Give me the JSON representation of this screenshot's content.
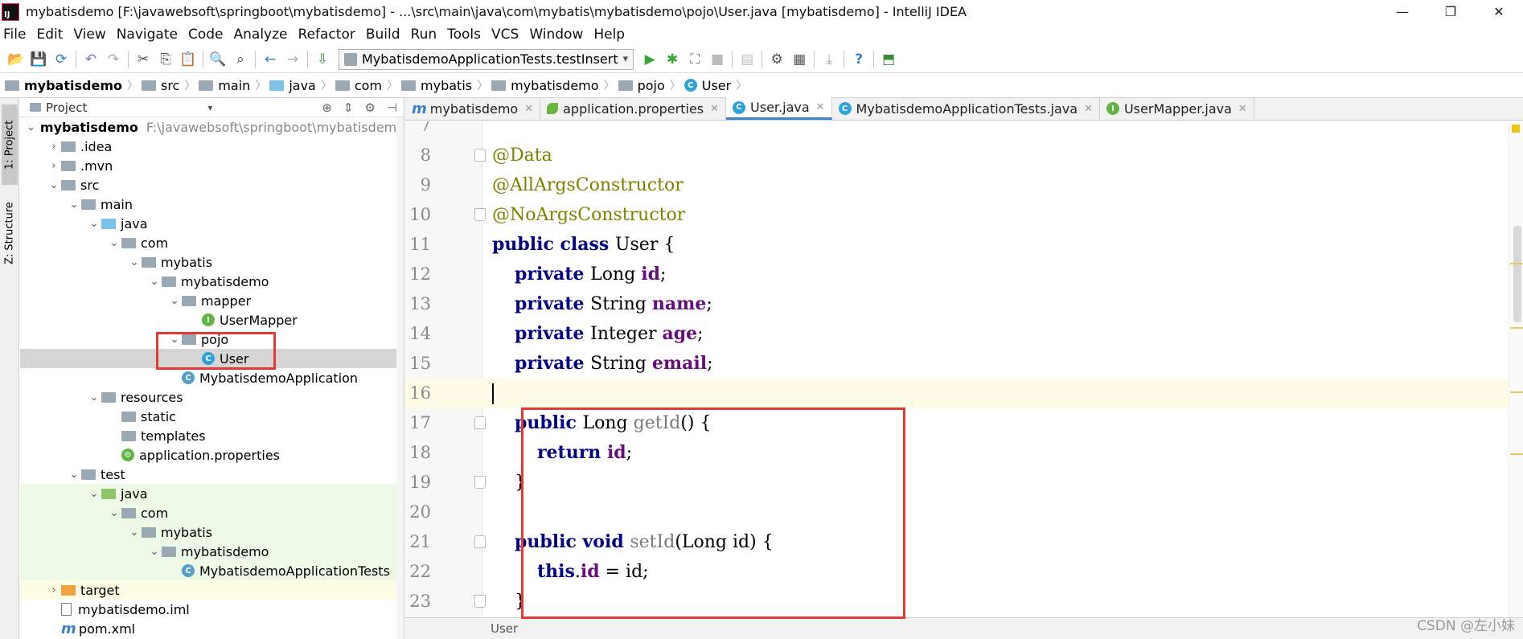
{
  "window": {
    "title": "mybatisdemo [F:\\javawebsoft\\springboot\\mybatisdemo] - ...\\src\\main\\java\\com\\mybatis\\mybatisdemo\\pojo\\User.java [mybatisdemo] - IntelliJ IDEA",
    "app_icon_text": "IJ",
    "controls": [
      "—",
      "❐",
      "✕"
    ]
  },
  "menu": [
    "File",
    "Edit",
    "View",
    "Navigate",
    "Code",
    "Analyze",
    "Refactor",
    "Build",
    "Run",
    "Tools",
    "VCS",
    "Window",
    "Help"
  ],
  "toolbar": {
    "run_config": "MybatisdemoApplicationTests.testInsert",
    "run_config_arrow": "▾",
    "icons": {
      "open": "📂",
      "save": "💾",
      "sync": "⟳",
      "undo": "↶",
      "redo": "↷",
      "cut": "✂",
      "copy": "⎘",
      "paste": "📋",
      "find": "🔍",
      "replace": "⌕",
      "back": "←",
      "forward": "→",
      "build": "⇩",
      "run": "▶",
      "debug": "✱",
      "coverage": "⛶",
      "stop": "■",
      "structure": "▤",
      "settings": "⚙",
      "project_structure": "▦",
      "sdk": "⤓",
      "help": "?",
      "vcs": "⬒"
    }
  },
  "breadcrumb": [
    {
      "label": "mybatisdemo",
      "icon": "folder"
    },
    {
      "label": "src",
      "icon": "folder"
    },
    {
      "label": "main",
      "icon": "folder"
    },
    {
      "label": "java",
      "icon": "folder-blue"
    },
    {
      "label": "com",
      "icon": "folder"
    },
    {
      "label": "mybatis",
      "icon": "folder"
    },
    {
      "label": "mybatisdemo",
      "icon": "folder"
    },
    {
      "label": "pojo",
      "icon": "folder"
    },
    {
      "label": "User",
      "icon": "class"
    }
  ],
  "side_tabs": {
    "project": "1: Project",
    "structure": "Z: Structure"
  },
  "project_panel": {
    "header": "Project",
    "header_arrow": "▾",
    "header_icons": {
      "locate": "⊕",
      "collapse": "⇕",
      "settings": "⚙",
      "hide": "⊣"
    },
    "expanded_arrow": "⌄",
    "collapsed_arrow": "›",
    "rows": [
      {
        "label": "mybatisdemo",
        "extra": "F:\\javawebsoft\\springboot\\mybatisdemo",
        "depth": 0,
        "arrow": "down",
        "icon": "proj",
        "bold": true
      },
      {
        "label": ".idea",
        "depth": 1,
        "arrow": "right",
        "icon": "folder"
      },
      {
        "label": ".mvn",
        "depth": 1,
        "arrow": "right",
        "icon": "folder"
      },
      {
        "label": "src",
        "depth": 1,
        "arrow": "down",
        "icon": "folder"
      },
      {
        "label": "main",
        "depth": 2,
        "arrow": "down",
        "icon": "folder"
      },
      {
        "label": "java",
        "depth": 3,
        "arrow": "down",
        "icon": "folder-blue"
      },
      {
        "label": "com",
        "depth": 4,
        "arrow": "down",
        "icon": "folder"
      },
      {
        "label": "mybatis",
        "depth": 5,
        "arrow": "down",
        "icon": "folder"
      },
      {
        "label": "mybatisdemo",
        "depth": 6,
        "arrow": "down",
        "icon": "folder"
      },
      {
        "label": "mapper",
        "depth": 7,
        "arrow": "down",
        "icon": "folder"
      },
      {
        "label": "UserMapper",
        "depth": 8,
        "arrow": "none",
        "icon": "interface"
      },
      {
        "label": "pojo",
        "depth": 7,
        "arrow": "down",
        "icon": "folder"
      },
      {
        "label": "User",
        "depth": 8,
        "arrow": "none",
        "icon": "class",
        "selected": true
      },
      {
        "label": "MybatisdemoApplication",
        "depth": 7,
        "arrow": "none",
        "icon": "spring-class"
      },
      {
        "label": "resources",
        "depth": 3,
        "arrow": "down",
        "icon": "folder"
      },
      {
        "label": "static",
        "depth": 4,
        "arrow": "none",
        "icon": "folder"
      },
      {
        "label": "templates",
        "depth": 4,
        "arrow": "none",
        "icon": "folder"
      },
      {
        "label": "application.properties",
        "depth": 4,
        "arrow": "none",
        "icon": "spring-props"
      },
      {
        "label": "test",
        "depth": 2,
        "arrow": "down",
        "icon": "folder"
      },
      {
        "label": "java",
        "depth": 3,
        "arrow": "down",
        "icon": "folder-green",
        "bg": "green"
      },
      {
        "label": "com",
        "depth": 4,
        "arrow": "down",
        "icon": "folder",
        "bg": "green"
      },
      {
        "label": "mybatis",
        "depth": 5,
        "arrow": "down",
        "icon": "folder",
        "bg": "green"
      },
      {
        "label": "mybatisdemo",
        "depth": 6,
        "arrow": "down",
        "icon": "folder",
        "bg": "green"
      },
      {
        "label": "MybatisdemoApplicationTests",
        "depth": 7,
        "arrow": "none",
        "icon": "spring-class",
        "bg": "green"
      },
      {
        "label": "target",
        "depth": 1,
        "arrow": "right",
        "icon": "folder-orange",
        "bg": "yellow"
      },
      {
        "label": "mybatisdemo.iml",
        "depth": 1,
        "arrow": "none",
        "icon": "file"
      },
      {
        "label": "pom.xml",
        "depth": 1,
        "arrow": "none",
        "icon": "maven"
      }
    ]
  },
  "editor_tabs": [
    {
      "label": "mybatisdemo",
      "icon": "m",
      "close": "✕"
    },
    {
      "label": "application.properties",
      "icon": "spring",
      "close": "✕"
    },
    {
      "label": "User.java",
      "icon": "class",
      "close": "✕",
      "active": true
    },
    {
      "label": "MybatisdemoApplicationTests.java",
      "icon": "class",
      "close": "✕"
    },
    {
      "label": "UserMapper.java",
      "icon": "interface",
      "close": "✕"
    }
  ],
  "code": [
    {
      "n": "7",
      "tokens": []
    },
    {
      "n": "8",
      "fold": "top",
      "tokens": [
        {
          "t": "@Data",
          "c": "ann"
        }
      ]
    },
    {
      "n": "9",
      "tokens": [
        {
          "t": "@AllArgsConstructor",
          "c": "ann"
        }
      ]
    },
    {
      "n": "10",
      "fold": "bottom",
      "tokens": [
        {
          "t": "@NoArgsConstructor",
          "c": "ann"
        }
      ]
    },
    {
      "n": "11",
      "tokens": [
        {
          "t": "public class ",
          "c": "kw"
        },
        {
          "t": "User {",
          "c": "plain"
        }
      ]
    },
    {
      "n": "12",
      "tokens": [
        {
          "t": "    ",
          "c": "plain"
        },
        {
          "t": "private ",
          "c": "kw"
        },
        {
          "t": "Long ",
          "c": "plain"
        },
        {
          "t": "id",
          "c": "fld"
        },
        {
          "t": ";",
          "c": "plain"
        }
      ]
    },
    {
      "n": "13",
      "tokens": [
        {
          "t": "    ",
          "c": "plain"
        },
        {
          "t": "private ",
          "c": "kw"
        },
        {
          "t": "String ",
          "c": "plain"
        },
        {
          "t": "name",
          "c": "fld"
        },
        {
          "t": ";",
          "c": "plain"
        }
      ]
    },
    {
      "n": "14",
      "tokens": [
        {
          "t": "    ",
          "c": "plain"
        },
        {
          "t": "private ",
          "c": "kw"
        },
        {
          "t": "Integer ",
          "c": "plain"
        },
        {
          "t": "age",
          "c": "fld"
        },
        {
          "t": ";",
          "c": "plain"
        }
      ]
    },
    {
      "n": "15",
      "tokens": [
        {
          "t": "    ",
          "c": "plain"
        },
        {
          "t": "private ",
          "c": "kw"
        },
        {
          "t": "String ",
          "c": "plain"
        },
        {
          "t": "email",
          "c": "fld"
        },
        {
          "t": ";",
          "c": "plain"
        }
      ]
    },
    {
      "n": "16",
      "current": true,
      "tokens": []
    },
    {
      "n": "17",
      "fold": "top",
      "tokens": [
        {
          "t": "    ",
          "c": "plain"
        },
        {
          "t": "public ",
          "c": "kw"
        },
        {
          "t": "Long ",
          "c": "plain"
        },
        {
          "t": "getId",
          "c": "mth-unused"
        },
        {
          "t": "() {",
          "c": "plain"
        }
      ]
    },
    {
      "n": "18",
      "tokens": [
        {
          "t": "        ",
          "c": "plain"
        },
        {
          "t": "return ",
          "c": "kw"
        },
        {
          "t": "id",
          "c": "fld"
        },
        {
          "t": ";",
          "c": "plain"
        }
      ]
    },
    {
      "n": "19",
      "fold": "bottom",
      "tokens": [
        {
          "t": "    }",
          "c": "plain"
        }
      ]
    },
    {
      "n": "20",
      "tokens": []
    },
    {
      "n": "21",
      "fold": "top",
      "tokens": [
        {
          "t": "    ",
          "c": "plain"
        },
        {
          "t": "public void ",
          "c": "kw"
        },
        {
          "t": "setId",
          "c": "mth-unused"
        },
        {
          "t": "(Long id) {",
          "c": "plain"
        }
      ]
    },
    {
      "n": "22",
      "tokens": [
        {
          "t": "        ",
          "c": "plain"
        },
        {
          "t": "this",
          "c": "kw"
        },
        {
          "t": ".",
          "c": "plain"
        },
        {
          "t": "id",
          "c": "fld"
        },
        {
          "t": " = id;",
          "c": "plain"
        }
      ]
    },
    {
      "n": "23",
      "fold": "bottom",
      "tokens": [
        {
          "t": "    }",
          "c": "plain"
        }
      ]
    }
  ],
  "status": {
    "breadcrumb": "User"
  },
  "watermark": "CSDN @左小妹",
  "colors": {
    "accent": "#4083c9",
    "highlight_box": "#e53935",
    "keyword": "#000080",
    "annotation": "#808000",
    "field": "#660e7a"
  }
}
